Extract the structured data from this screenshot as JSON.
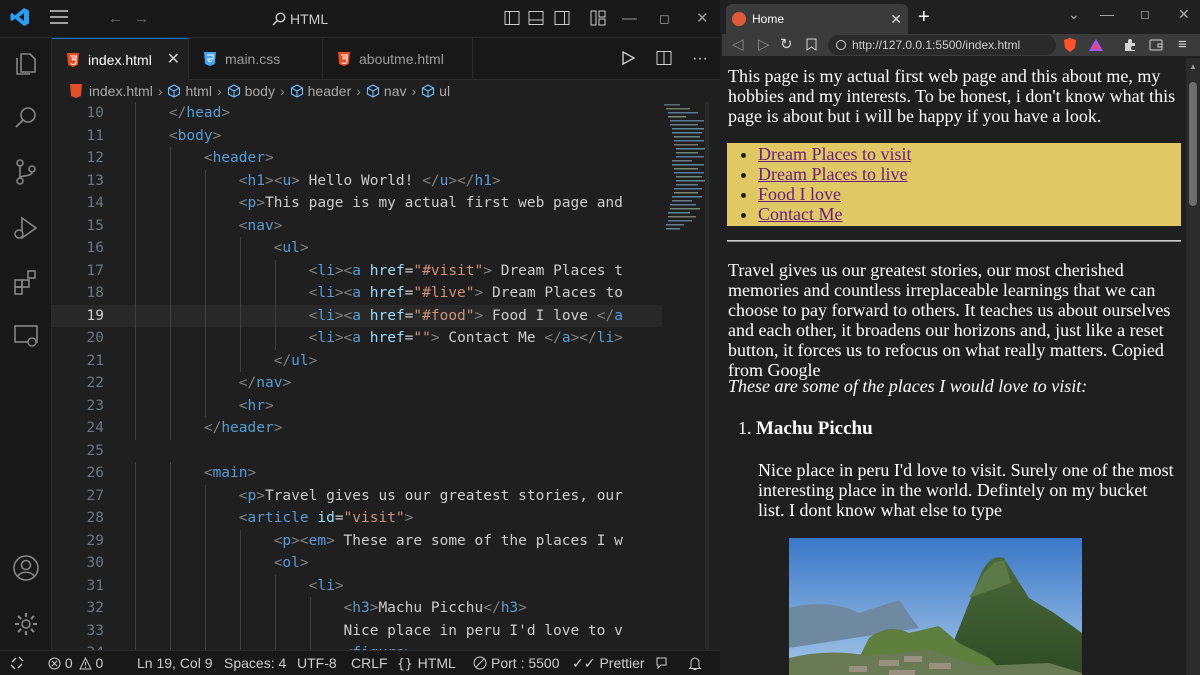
{
  "vscode": {
    "search_label": "HTML",
    "tabs": [
      {
        "label": "index.html",
        "type": "html",
        "active": true
      },
      {
        "label": "main.css",
        "type": "css",
        "active": false
      },
      {
        "label": "aboutme.html",
        "type": "html",
        "active": false
      }
    ],
    "breadcrumbs": [
      "index.html",
      "html",
      "body",
      "header",
      "nav",
      "ul"
    ],
    "lines": [
      {
        "n": "10",
        "code": "    </head>"
      },
      {
        "n": "11",
        "code": "    <body>"
      },
      {
        "n": "12",
        "code": "        <header>"
      },
      {
        "n": "13",
        "code": "            <h1><u> Hello World! </u></h1>"
      },
      {
        "n": "14",
        "code": "            <p>This page is my actual first web page and"
      },
      {
        "n": "15",
        "code": "            <nav>"
      },
      {
        "n": "16",
        "code": "                <ul>"
      },
      {
        "n": "17",
        "code": "                    <li><a href=\"#visit\"> Dream Places t"
      },
      {
        "n": "18",
        "code": "                    <li><a href=\"#live\"> Dream Places to"
      },
      {
        "n": "19",
        "code": "                    <li><a href=\"#food\"> Food I love </a"
      },
      {
        "n": "20",
        "code": "                    <li><a href=\"\"> Contact Me </a></li>"
      },
      {
        "n": "21",
        "code": "                </ul>"
      },
      {
        "n": "22",
        "code": "            </nav>"
      },
      {
        "n": "23",
        "code": "            <hr>"
      },
      {
        "n": "24",
        "code": "        </header>"
      },
      {
        "n": "25",
        "code": ""
      },
      {
        "n": "26",
        "code": "        <main>"
      },
      {
        "n": "27",
        "code": "            <p>Travel gives us our greatest stories, our"
      },
      {
        "n": "28",
        "code": "            <article id=\"visit\">"
      },
      {
        "n": "29",
        "code": "                <p><em> These are some of the places I w"
      },
      {
        "n": "30",
        "code": "                <ol>"
      },
      {
        "n": "31",
        "code": "                    <li>"
      },
      {
        "n": "32",
        "code": "                        <h3>Machu Picchu</h3>"
      },
      {
        "n": "33",
        "code": "                        Nice place in peru I'd love to v"
      },
      {
        "n": "34",
        "code": "                        <figure>"
      }
    ],
    "current_line": "19",
    "status": {
      "errors": "0",
      "warnings": "0",
      "position": "Ln 19, Col 9",
      "spaces": "Spaces: 4",
      "encoding": "UTF-8",
      "eol": "CRLF",
      "language": "HTML",
      "port": "Port : 5500",
      "formatter": "Prettier"
    }
  },
  "browser": {
    "tab_title": "Home",
    "url": "http://127.0.0.1:5500/index.html",
    "page": {
      "intro": "This page is my actual first web page and this about me, my hobbies and my interests. To be honest, i don't know what this page is about but i will be happy if you have a look.",
      "nav_links": [
        "Dream Places to visit",
        "Dream Places to live",
        "Food I love",
        "Contact Me"
      ],
      "travel": "Travel gives us our greatest stories, our most cherished memories and countless irreplaceable learnings that we can choose to pay forward to others. It teaches us about ourselves and each other, it broadens our horizons and, just like a reset button, it forces us to refocus on what really matters. Copied from Google",
      "places_intro": "These are some of the places I would love to visit:",
      "place_number": "1.",
      "place_title": "Machu Picchu",
      "place_text": "Nice place in peru I'd love to visit. Surely one of the most interesting place in the world. Defintely on my bucket list. I dont know what else to type"
    }
  }
}
